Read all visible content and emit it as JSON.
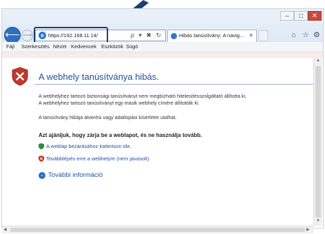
{
  "window": {
    "controls": {
      "minimize": "–",
      "maximize": "□",
      "close": "✕"
    }
  },
  "address": {
    "url": "https://192.168.11.14/",
    "tools": "ρ ▾ ✖ ↻"
  },
  "tab": {
    "title": "Hibás tanúsítvány: A navig...",
    "close": "✕"
  },
  "menu": [
    "Fájl",
    "Szerkesztés",
    "Nézet",
    "Kedvencek",
    "Eszközök",
    "Súgó"
  ],
  "page": {
    "heading": "A webhely tanúsítványa hibás.",
    "para1_line1": "A webhelyhez tartozó biztonsági tanúsítványt nem megbízható hitelesítésszolgáltató állította ki.",
    "para1_line2": "A webhelyhez tartozó tanúsítványt egy másik webhely címére állították ki.",
    "para2": "A tanúsítvány hibája átverési vagy adatlopási kísérletre utalhat.",
    "recommendation": "Azt ajánljuk, hogy zárja be a weblapot, és ne használja tovább.",
    "close_link": "A weblap bezárásához kattintson ide.",
    "continue_link": "Továbblépés erre a webhelyre (nem javasolt).",
    "more_info": "További információ"
  },
  "icons": {
    "back": "back-arrow-icon",
    "forward": "forward-arrow-icon",
    "shield": "error-shield-icon",
    "home": "home-icon",
    "favorites": "star-icon",
    "settings": "gear-icon"
  },
  "colors": {
    "accent": "#1f4f9e",
    "arrow": "#1d3f77",
    "error_red": "#c0392b"
  }
}
